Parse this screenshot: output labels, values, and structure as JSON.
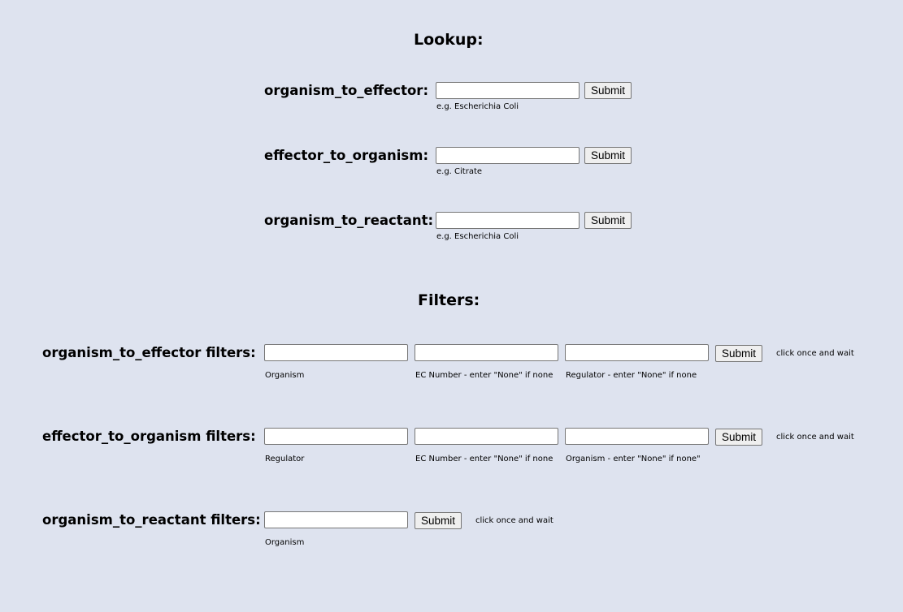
{
  "lookup": {
    "title": "Lookup:",
    "rows": [
      {
        "label": "organism_to_effector:",
        "value": "",
        "button": "Submit",
        "hint": "e.g. Escherichia Coli"
      },
      {
        "label": "effector_to_organism:",
        "value": "",
        "button": "Submit",
        "hint": "e.g. Citrate"
      },
      {
        "label": "organism_to_reactant:",
        "value": "",
        "button": "Submit",
        "hint": "e.g. Escherichia Coli"
      }
    ]
  },
  "filters": {
    "title": "Filters:",
    "rows": [
      {
        "label": "organism_to_effector filters:",
        "fields": [
          {
            "value": "",
            "hint": "Organism"
          },
          {
            "value": "",
            "hint": "EC Number - enter \"None\" if none"
          },
          {
            "value": "",
            "hint": "Regulator - enter \"None\" if none"
          }
        ],
        "button": "Submit",
        "note": "click once and wait"
      },
      {
        "label": "effector_to_organism filters:",
        "fields": [
          {
            "value": "",
            "hint": "Regulator"
          },
          {
            "value": "",
            "hint": "EC Number - enter \"None\" if none"
          },
          {
            "value": "",
            "hint": "Organism - enter \"None\" if none\""
          }
        ],
        "button": "Submit",
        "note": "click once and wait"
      },
      {
        "label": "organism_to_reactant filters:",
        "fields": [
          {
            "value": "",
            "hint": "Organism"
          }
        ],
        "button": "Submit",
        "note": "click once and wait"
      }
    ]
  }
}
